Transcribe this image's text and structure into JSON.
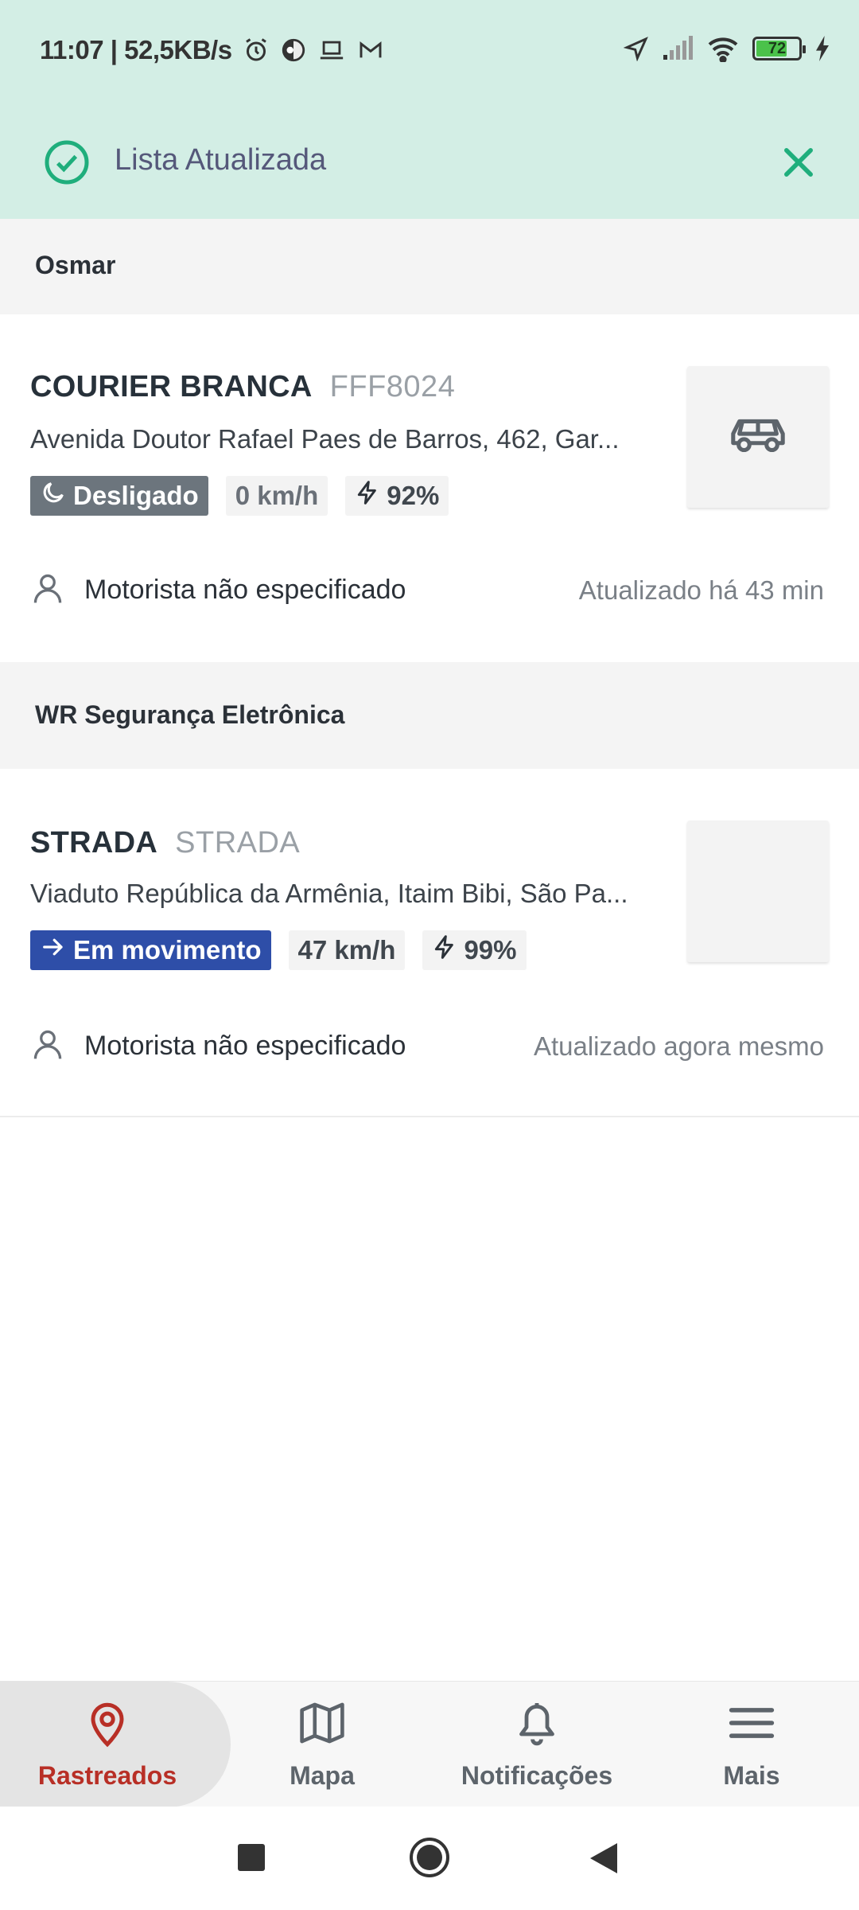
{
  "status_bar": {
    "time_speed": "11:07 | 52,5KB/s",
    "battery_level": "72"
  },
  "toast": {
    "message": "Lista Atualizada",
    "accent_color": "#1fae7c"
  },
  "groups": [
    {
      "name": "Osmar",
      "vehicles": [
        {
          "name": "COURIER BRANCA",
          "plate": "FFF8024",
          "address": "Avenida Doutor Rafael Paes de Barros, 462, Gar...",
          "status": "Desligado",
          "status_icon": "moon-icon",
          "speed": "0 km/h",
          "battery": "92%",
          "driver": "Motorista não especificado",
          "updated": "Atualizado há 43 min",
          "thumb_icon": "car-icon"
        }
      ]
    },
    {
      "name": "WR Segurança Eletrônica",
      "vehicles": [
        {
          "name": "STRADA",
          "plate": "STRADA",
          "address": "Viaduto República da Armênia, Itaim Bibi, São Pa...",
          "status": "Em movimento",
          "status_icon": "arrow-right-icon",
          "speed": "47 km/h",
          "battery": "99%",
          "driver": "Motorista não especificado",
          "updated": "Atualizado agora mesmo",
          "thumb_icon": ""
        }
      ]
    }
  ],
  "bottom_nav": {
    "items": [
      {
        "label": "Rastreados",
        "icon": "map-pin-icon",
        "active": true
      },
      {
        "label": "Mapa",
        "icon": "map-icon",
        "active": false
      },
      {
        "label": "Notificações",
        "icon": "bell-icon",
        "active": false
      },
      {
        "label": "Mais",
        "icon": "menu-icon",
        "active": false
      }
    ],
    "active_color": "#b82f26"
  }
}
